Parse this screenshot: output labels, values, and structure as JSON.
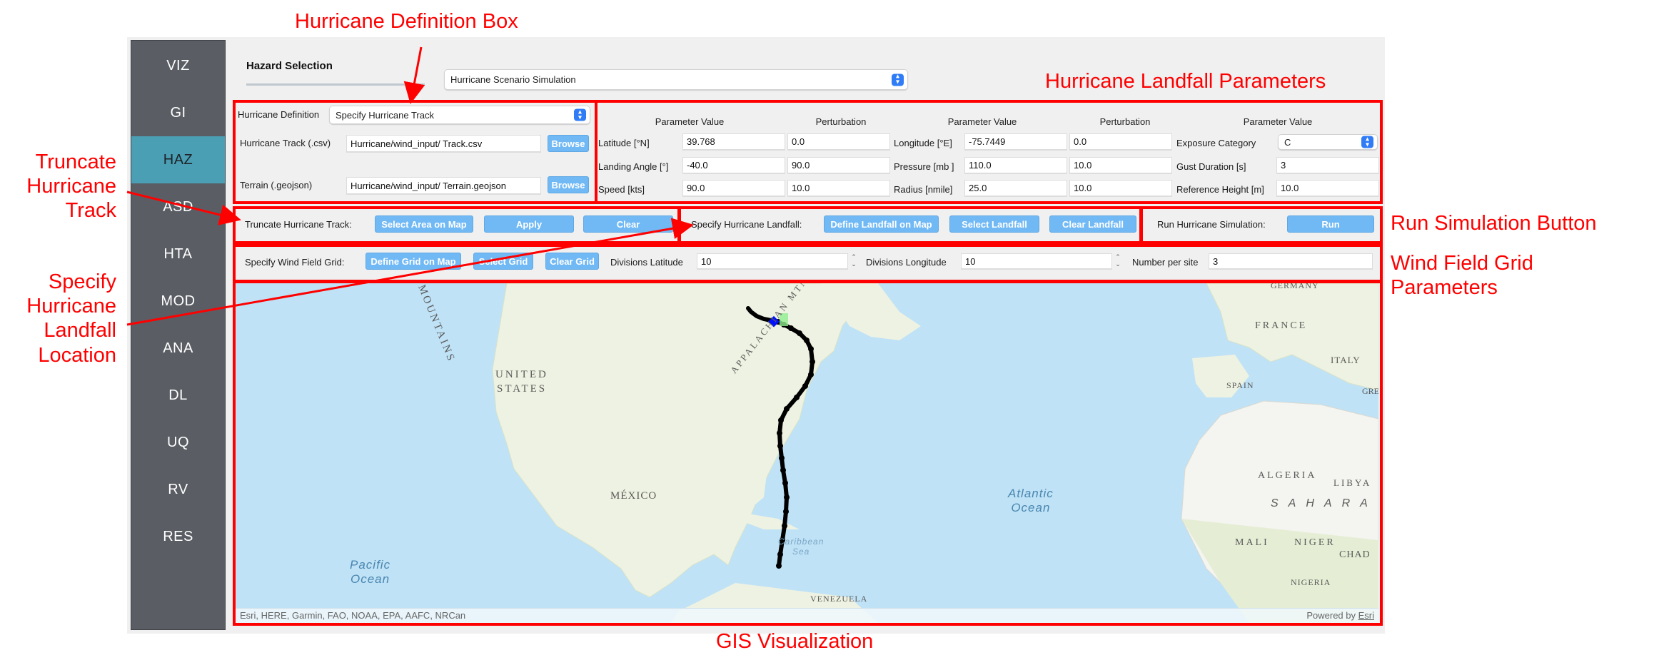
{
  "sidebar": {
    "items": [
      {
        "label": "VIZ",
        "active": false
      },
      {
        "label": "GI",
        "active": false
      },
      {
        "label": "HAZ",
        "active": true
      },
      {
        "label": "ASD",
        "active": false
      },
      {
        "label": "HTA",
        "active": false
      },
      {
        "label": "MOD",
        "active": false
      },
      {
        "label": "ANA",
        "active": false
      },
      {
        "label": "DL",
        "active": false
      },
      {
        "label": "UQ",
        "active": false
      },
      {
        "label": "RV",
        "active": false
      },
      {
        "label": "RES",
        "active": false
      }
    ]
  },
  "hazard": {
    "label": "Hazard Selection",
    "selected": "Hurricane Scenario Simulation"
  },
  "definition": {
    "label": "Hurricane Definition",
    "selected": "Specify Hurricane Track",
    "track_label": "Hurricane Track (.csv)",
    "track_value": "Hurricane/wind_input/ Track.csv",
    "terrain_label": "Terrain (.geojson)",
    "terrain_value": "Hurricane/wind_input/ Terrain.geojson",
    "browse_label": "Browse"
  },
  "landfall_params": {
    "headers": {
      "param_value": "Parameter Value",
      "perturbation": "Perturbation"
    },
    "left": [
      {
        "label": "Latitude [°N]",
        "value": "39.768",
        "perturbation": "0.0"
      },
      {
        "label": "Landing Angle [°]",
        "value": "-40.0",
        "perturbation": "90.0"
      },
      {
        "label": "Speed [kts]",
        "value": "90.0",
        "perturbation": "10.0"
      }
    ],
    "middle": [
      {
        "label": "Longitude [°E]",
        "value": "-75.7449",
        "perturbation": "0.0"
      },
      {
        "label": "Pressure [mb ]",
        "value": "110.0",
        "perturbation": "10.0"
      },
      {
        "label": "Radius [nmile]",
        "value": "25.0",
        "perturbation": "10.0"
      }
    ],
    "right": [
      {
        "label": "Exposure Category",
        "value": "C"
      },
      {
        "label": "Gust Duration [s]",
        "value": "3"
      },
      {
        "label": "Reference Height [m]",
        "value": "10.0"
      }
    ]
  },
  "truncate": {
    "label": "Truncate Hurricane Track:",
    "select_area": "Select Area on Map",
    "apply": "Apply",
    "clear": "Clear"
  },
  "landfall": {
    "label": "Specify Hurricane Landfall:",
    "define": "Define Landfall on Map",
    "select": "Select Landfall",
    "clear": "Clear Landfall"
  },
  "run": {
    "label": "Run Hurricane Simulation:",
    "button": "Run"
  },
  "grid": {
    "label": "Specify Wind Field Grid:",
    "define": "Define Grid on Map",
    "select": "Select Grid",
    "clear": "Clear Grid",
    "div_lat_label": "Divisions Latitude",
    "div_lat_value": "10",
    "div_lon_label": "Divisions Longitude",
    "div_lon_value": "10",
    "per_site_label": "Number per site",
    "per_site_value": "3"
  },
  "map": {
    "labels": {
      "us1": "UNITED",
      "us2": "STATES",
      "mountains": "MOUNTAINS",
      "appalachian": "APPALACHIAN MTNS",
      "mexico": "MÉXICO",
      "pacific1": "Pacific",
      "pacific2": "Ocean",
      "atlantic1": "Atlantic",
      "atlantic2": "Ocean",
      "caribbean1": "Caribbean",
      "caribbean2": "Sea",
      "venezuela": "VENEZUELA",
      "germany": "GERMANY",
      "france": "FRANCE",
      "spain": "SPAIN",
      "italy": "ITALY",
      "greece": "GREEC",
      "algeria": "ALGERIA",
      "libya": "LIBYA",
      "sahara": "SAHARA",
      "mali": "MALI",
      "niger": "NIGER",
      "chad": "CHAD",
      "nigeria": "NIGERIA"
    },
    "attribution": "Esri, HERE, Garmin, FAO, NOAA, EPA, AAFC, NRCan",
    "powered_prefix": "Powered by ",
    "powered_link": "Esri",
    "track_color": "#000000",
    "landfall_marker_color": "#0010ff",
    "landfall_highlight_color": "#90ee90"
  },
  "annotations": {
    "definition_box": "Hurricane Definition Box",
    "landfall_params": "Hurricane Landfall Parameters",
    "truncate": [
      "Truncate",
      "Hurricane",
      "Track"
    ],
    "specify_landfall": [
      "Specify",
      "Hurricane",
      "Landfall",
      "Location"
    ],
    "run_button": "Run Simulation Button",
    "wind_grid": [
      "Wind Field Grid",
      "Parameters"
    ],
    "gis": "GIS Visualization"
  }
}
